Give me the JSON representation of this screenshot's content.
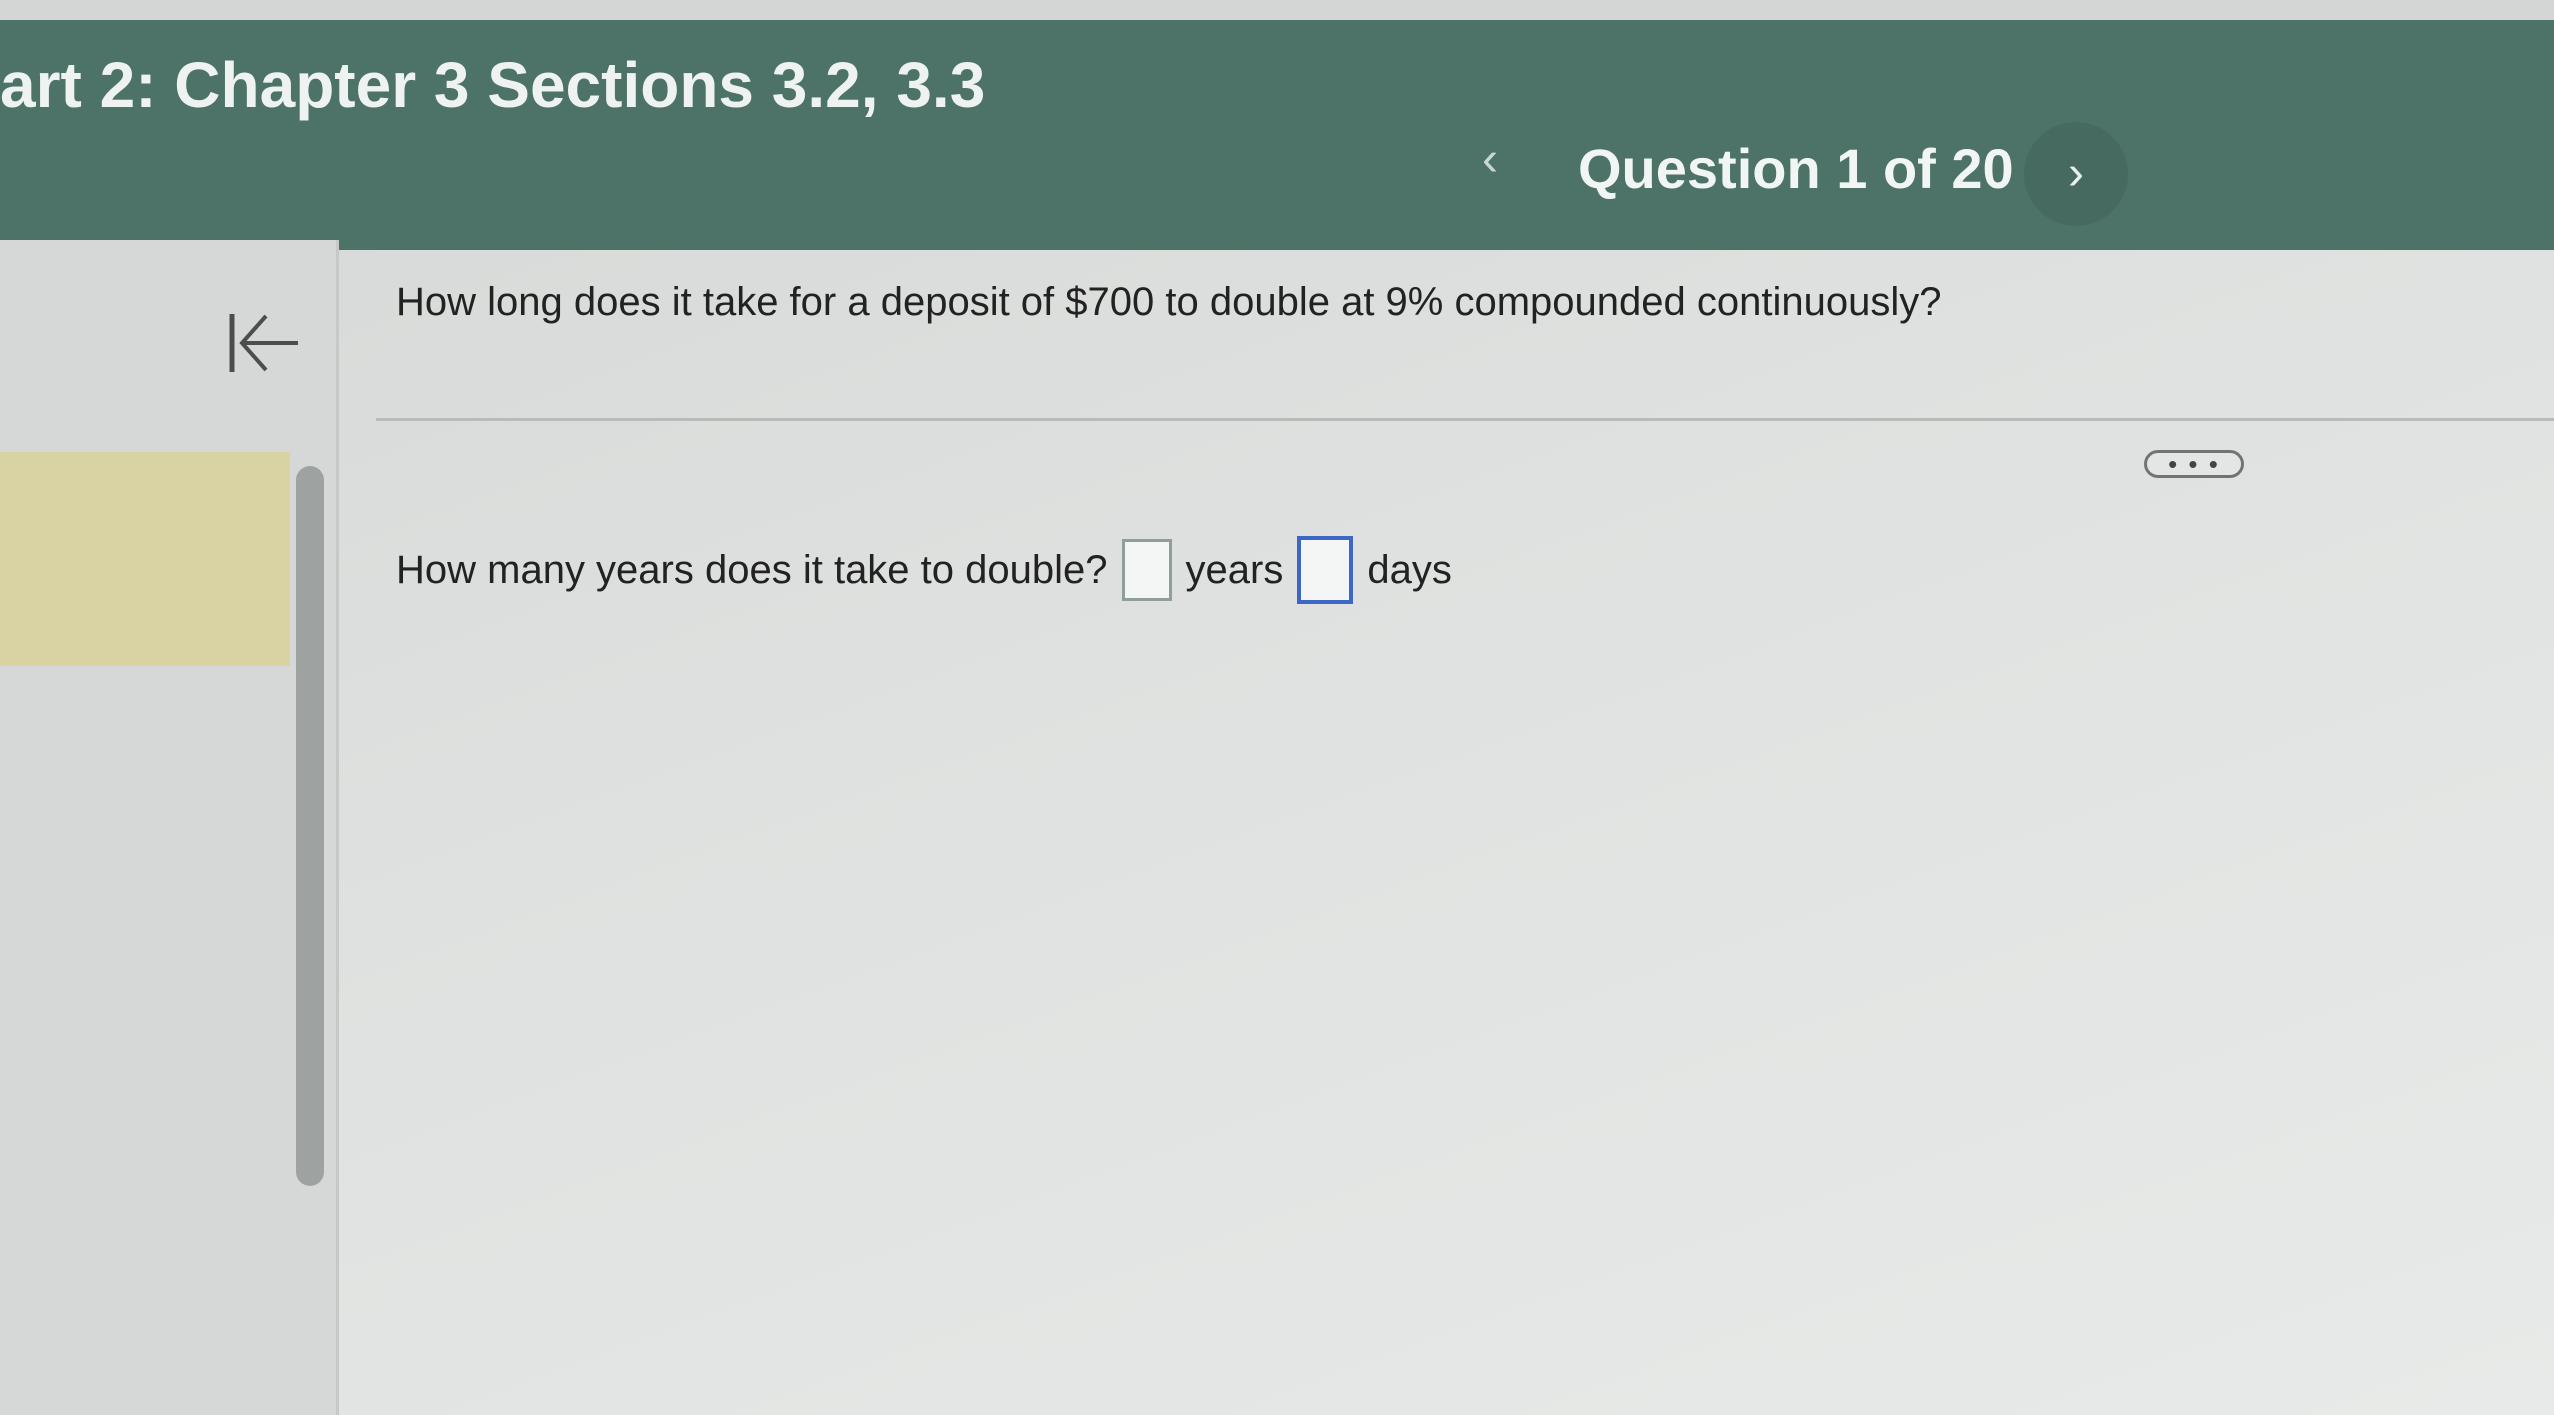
{
  "header": {
    "assignment_title": "art 2: Chapter 3 Sections 3.2, 3.3",
    "question_counter": "Question 1 of 20",
    "prev_icon": "‹",
    "next_icon": "›"
  },
  "sidebar": {
    "collapse_icon": "collapse-left-icon"
  },
  "question": {
    "prompt": "How long does it take for a deposit of $700 to double at 9% compounded continuously?",
    "more_label": "• • •",
    "answer_prompt": "How many years does it take to double?",
    "years_value": "",
    "years_unit": "years",
    "days_value": "",
    "days_unit": "days"
  },
  "colors": {
    "header_bg": "#4d7268",
    "highlight": "#d9d2a2",
    "active_input_border": "#3d67c4"
  }
}
